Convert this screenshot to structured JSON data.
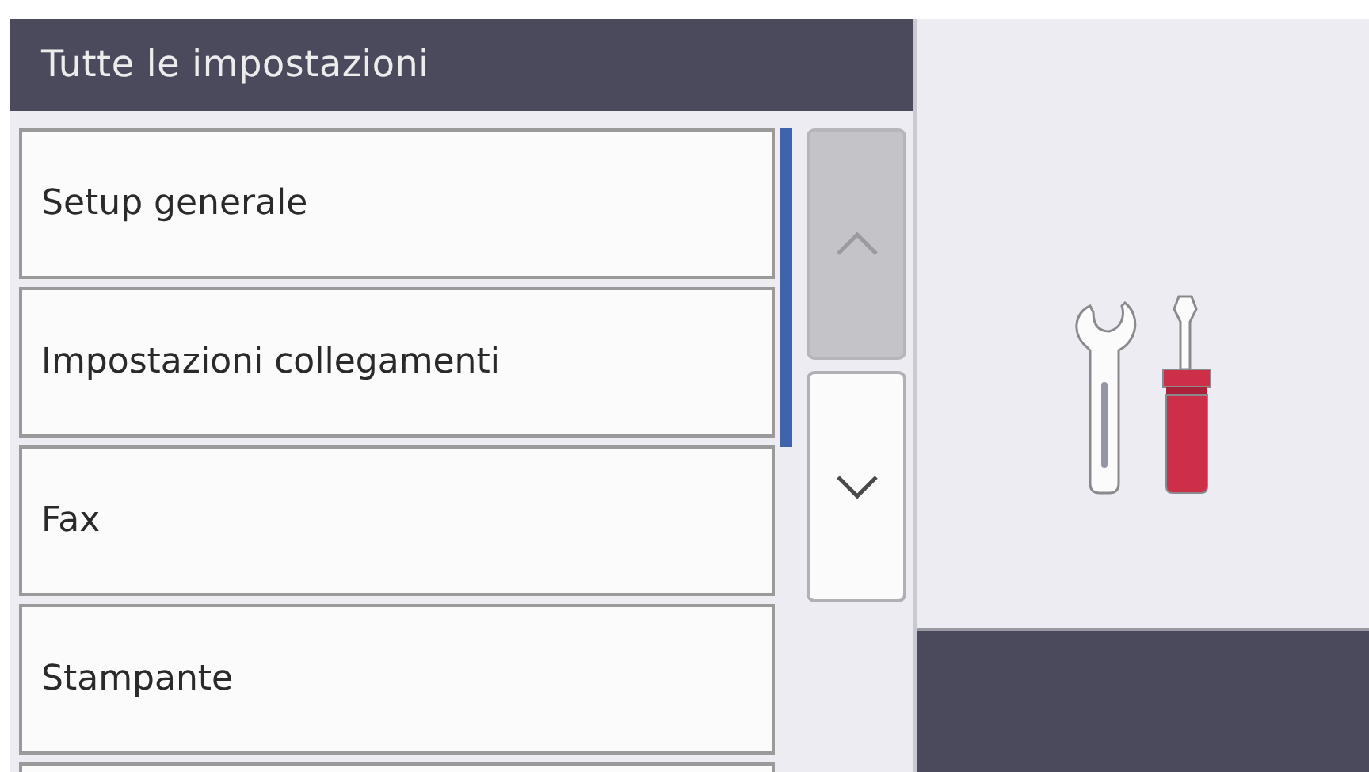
{
  "header": {
    "title": "Tutte le impostazioni"
  },
  "menu_items": [
    {
      "label": "Setup generale"
    },
    {
      "label": "Impostazioni collegamenti"
    },
    {
      "label": "Fax"
    },
    {
      "label": "Stampante"
    }
  ],
  "scroll_buttons": [
    {
      "kind": "up",
      "disabled": true
    },
    {
      "kind": "down",
      "disabled": false
    }
  ]
}
